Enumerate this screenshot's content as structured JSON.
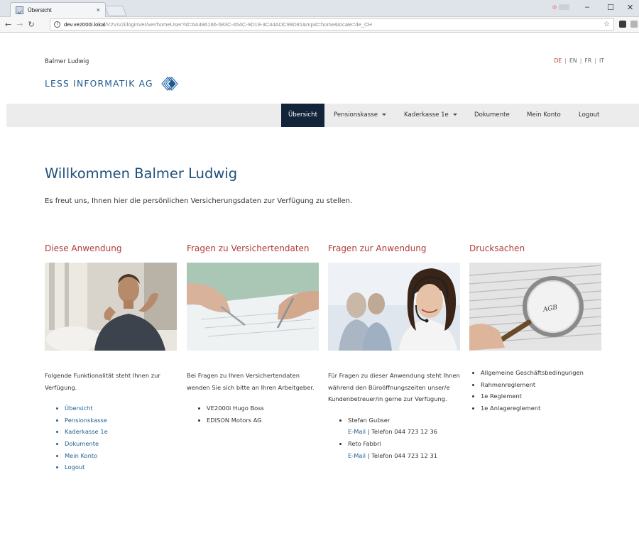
{
  "browser": {
    "tab_title": "Übersicht",
    "tab_close": "×",
    "url_host": "dev.ve2000i.lokal",
    "url_path": "/V2V/v2i/loginVer/ver/homeUser?id=6A486166-583C-454C-9D19-3C44ADC99D81&mpid=home&locale=de_CH",
    "window_controls": [
      "–",
      "☐",
      "✕"
    ]
  },
  "header": {
    "user_name": "Balmer Ludwig",
    "logo_text": "LESS INFORMATIK AG",
    "languages": [
      {
        "code": "DE",
        "active": true
      },
      {
        "code": "EN",
        "active": false
      },
      {
        "code": "FR",
        "active": false
      },
      {
        "code": "IT",
        "active": false
      }
    ],
    "lang_sep": "|"
  },
  "nav": {
    "items": [
      {
        "label": "Übersicht",
        "active": true,
        "dropdown": false
      },
      {
        "label": "Pensionskasse",
        "active": false,
        "dropdown": true
      },
      {
        "label": "Kaderkasse 1e",
        "active": false,
        "dropdown": true
      },
      {
        "label": "Dokumente",
        "active": false,
        "dropdown": false
      },
      {
        "label": "Mein Konto",
        "active": false,
        "dropdown": false
      },
      {
        "label": "Logout",
        "active": false,
        "dropdown": false
      }
    ]
  },
  "main": {
    "title": "Willkommen Balmer Ludwig",
    "intro": "Es freut uns, Ihnen hier die persönlichen Versicherungsdaten zur Verfügung zu stellen.",
    "columns": [
      {
        "heading": "Diese Anwendung",
        "text": "Folgende Funktionalität steht Ihnen zur Verfügung.",
        "links": [
          "Übersicht",
          "Pensionskasse",
          "Kaderkasse 1e",
          "Dokumente",
          "Mein Konto",
          "Logout"
        ]
      },
      {
        "heading": "Fragen zu Versichertendaten",
        "text": "Bei Fragen zu Ihren Versichertendaten wenden Sie sich bitte an Ihren Arbeitgeber.",
        "items": [
          "VE2000i Hugo Boss",
          "EDISON Motors AG"
        ]
      },
      {
        "heading": "Fragen zur Anwendung",
        "text": "Für Fragen zu dieser Anwendung steht Ihnen während den Büroöffnungszeiten unser/e Kundenbetreuer/in gerne zur Verfügung.",
        "contacts": [
          {
            "name": "Stefan Gubser",
            "email": "E-Mail",
            "sep": "|",
            "phone": "Telefon 044 723 12 36"
          },
          {
            "name": "Reto Fabbri",
            "email": "E-Mail",
            "sep": "|",
            "phone": "Telefon 044 723 12 31"
          }
        ]
      },
      {
        "heading": "Drucksachen",
        "image_text": "AGB",
        "items": [
          "Allgemeine Geschäftsbedingungen",
          "Rahmenreglement",
          "1e Reglement",
          "1e Anlagereglement"
        ]
      }
    ]
  },
  "colors": {
    "accent_red": "#b03a3a",
    "brand_blue": "#1f4f7a",
    "nav_active_bg": "#13243a",
    "link_blue": "#1f5e91"
  }
}
